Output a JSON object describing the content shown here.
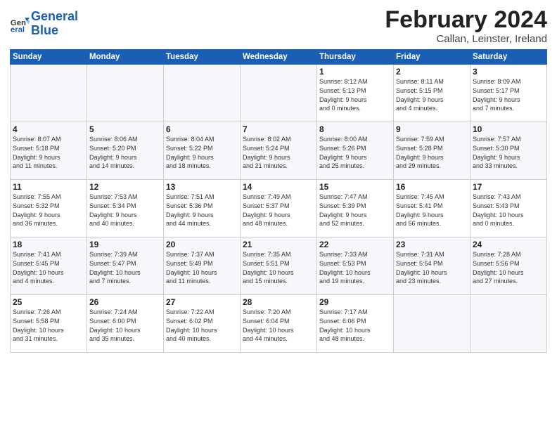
{
  "header": {
    "logo_line1": "General",
    "logo_line2": "Blue",
    "title": "February 2024",
    "subtitle": "Callan, Leinster, Ireland"
  },
  "weekdays": [
    "Sunday",
    "Monday",
    "Tuesday",
    "Wednesday",
    "Thursday",
    "Friday",
    "Saturday"
  ],
  "weeks": [
    [
      {
        "day": "",
        "info": ""
      },
      {
        "day": "",
        "info": ""
      },
      {
        "day": "",
        "info": ""
      },
      {
        "day": "",
        "info": ""
      },
      {
        "day": "1",
        "info": "Sunrise: 8:12 AM\nSunset: 5:13 PM\nDaylight: 9 hours\nand 0 minutes."
      },
      {
        "day": "2",
        "info": "Sunrise: 8:11 AM\nSunset: 5:15 PM\nDaylight: 9 hours\nand 4 minutes."
      },
      {
        "day": "3",
        "info": "Sunrise: 8:09 AM\nSunset: 5:17 PM\nDaylight: 9 hours\nand 7 minutes."
      }
    ],
    [
      {
        "day": "4",
        "info": "Sunrise: 8:07 AM\nSunset: 5:18 PM\nDaylight: 9 hours\nand 11 minutes."
      },
      {
        "day": "5",
        "info": "Sunrise: 8:06 AM\nSunset: 5:20 PM\nDaylight: 9 hours\nand 14 minutes."
      },
      {
        "day": "6",
        "info": "Sunrise: 8:04 AM\nSunset: 5:22 PM\nDaylight: 9 hours\nand 18 minutes."
      },
      {
        "day": "7",
        "info": "Sunrise: 8:02 AM\nSunset: 5:24 PM\nDaylight: 9 hours\nand 21 minutes."
      },
      {
        "day": "8",
        "info": "Sunrise: 8:00 AM\nSunset: 5:26 PM\nDaylight: 9 hours\nand 25 minutes."
      },
      {
        "day": "9",
        "info": "Sunrise: 7:59 AM\nSunset: 5:28 PM\nDaylight: 9 hours\nand 29 minutes."
      },
      {
        "day": "10",
        "info": "Sunrise: 7:57 AM\nSunset: 5:30 PM\nDaylight: 9 hours\nand 33 minutes."
      }
    ],
    [
      {
        "day": "11",
        "info": "Sunrise: 7:55 AM\nSunset: 5:32 PM\nDaylight: 9 hours\nand 36 minutes."
      },
      {
        "day": "12",
        "info": "Sunrise: 7:53 AM\nSunset: 5:34 PM\nDaylight: 9 hours\nand 40 minutes."
      },
      {
        "day": "13",
        "info": "Sunrise: 7:51 AM\nSunset: 5:36 PM\nDaylight: 9 hours\nand 44 minutes."
      },
      {
        "day": "14",
        "info": "Sunrise: 7:49 AM\nSunset: 5:37 PM\nDaylight: 9 hours\nand 48 minutes."
      },
      {
        "day": "15",
        "info": "Sunrise: 7:47 AM\nSunset: 5:39 PM\nDaylight: 9 hours\nand 52 minutes."
      },
      {
        "day": "16",
        "info": "Sunrise: 7:45 AM\nSunset: 5:41 PM\nDaylight: 9 hours\nand 56 minutes."
      },
      {
        "day": "17",
        "info": "Sunrise: 7:43 AM\nSunset: 5:43 PM\nDaylight: 10 hours\nand 0 minutes."
      }
    ],
    [
      {
        "day": "18",
        "info": "Sunrise: 7:41 AM\nSunset: 5:45 PM\nDaylight: 10 hours\nand 4 minutes."
      },
      {
        "day": "19",
        "info": "Sunrise: 7:39 AM\nSunset: 5:47 PM\nDaylight: 10 hours\nand 7 minutes."
      },
      {
        "day": "20",
        "info": "Sunrise: 7:37 AM\nSunset: 5:49 PM\nDaylight: 10 hours\nand 11 minutes."
      },
      {
        "day": "21",
        "info": "Sunrise: 7:35 AM\nSunset: 5:51 PM\nDaylight: 10 hours\nand 15 minutes."
      },
      {
        "day": "22",
        "info": "Sunrise: 7:33 AM\nSunset: 5:53 PM\nDaylight: 10 hours\nand 19 minutes."
      },
      {
        "day": "23",
        "info": "Sunrise: 7:31 AM\nSunset: 5:54 PM\nDaylight: 10 hours\nand 23 minutes."
      },
      {
        "day": "24",
        "info": "Sunrise: 7:28 AM\nSunset: 5:56 PM\nDaylight: 10 hours\nand 27 minutes."
      }
    ],
    [
      {
        "day": "25",
        "info": "Sunrise: 7:26 AM\nSunset: 5:58 PM\nDaylight: 10 hours\nand 31 minutes."
      },
      {
        "day": "26",
        "info": "Sunrise: 7:24 AM\nSunset: 6:00 PM\nDaylight: 10 hours\nand 35 minutes."
      },
      {
        "day": "27",
        "info": "Sunrise: 7:22 AM\nSunset: 6:02 PM\nDaylight: 10 hours\nand 40 minutes."
      },
      {
        "day": "28",
        "info": "Sunrise: 7:20 AM\nSunset: 6:04 PM\nDaylight: 10 hours\nand 44 minutes."
      },
      {
        "day": "29",
        "info": "Sunrise: 7:17 AM\nSunset: 6:06 PM\nDaylight: 10 hours\nand 48 minutes."
      },
      {
        "day": "",
        "info": ""
      },
      {
        "day": "",
        "info": ""
      }
    ]
  ]
}
